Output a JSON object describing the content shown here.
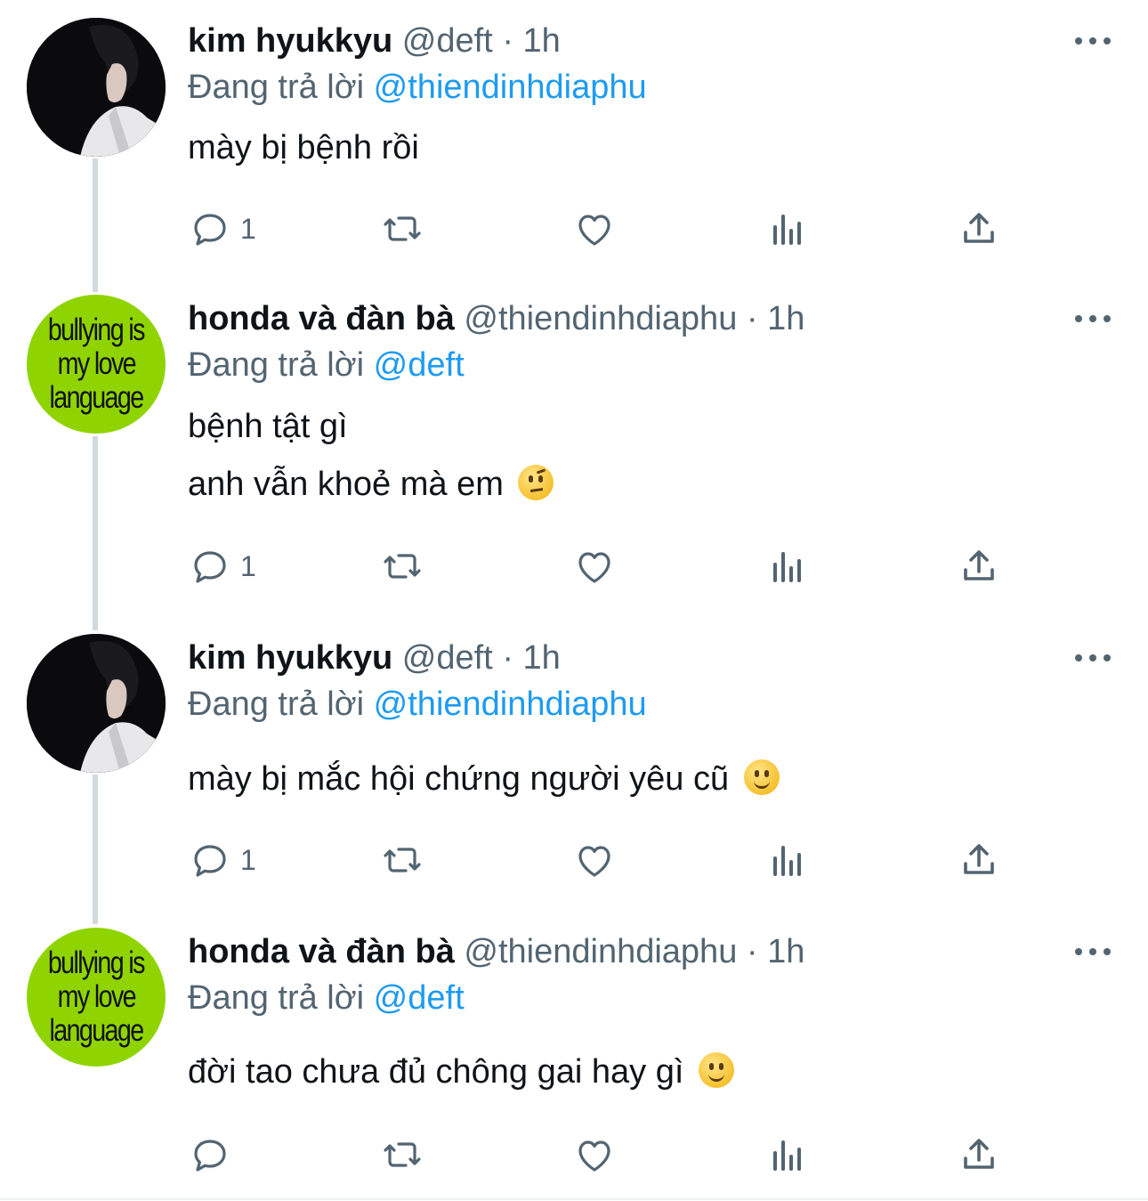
{
  "tweets": [
    {
      "name": "kim hyukkyu",
      "handle": "@deft",
      "time": "1h",
      "reply_prefix": "Đang trả lời",
      "reply_to": "@thiendinhdiaphu",
      "lines": [
        "mày bị bệnh rồi"
      ],
      "emoji": null,
      "reply_count": "1",
      "avatar": "dark-portrait-avatar"
    },
    {
      "name": "honda và đàn bà",
      "handle": "@thiendinhdiaphu",
      "time": "1h",
      "reply_prefix": "Đang trả lời",
      "reply_to": "@deft",
      "lines": [
        "bệnh tật gì",
        "anh vẫn khoẻ mà em"
      ],
      "emoji": "face-with-raised-eyebrow",
      "reply_count": "1",
      "avatar_text": [
        "bullying is",
        "my love",
        "language"
      ]
    },
    {
      "name": "kim hyukkyu",
      "handle": "@deft",
      "time": "1h",
      "reply_prefix": "Đang trả lời",
      "reply_to": "@thiendinhdiaphu",
      "lines": [
        "mày bị mắc hội chứng người yêu cũ"
      ],
      "emoji": "slightly-smiling-face",
      "reply_count": "1",
      "avatar": "dark-portrait-avatar"
    },
    {
      "name": "honda và đàn bà",
      "handle": "@thiendinhdiaphu",
      "time": "1h",
      "reply_prefix": "Đang trả lời",
      "reply_to": "@deft",
      "lines": [
        "đời tao chưa đủ chông gai hay gì"
      ],
      "emoji": "slightly-smiling-face",
      "reply_count": "",
      "avatar_text": [
        "bullying is",
        "my love",
        "language"
      ]
    }
  ],
  "separator": "·",
  "icons": [
    "reply-icon",
    "retweet-icon",
    "like-icon",
    "analytics-icon",
    "share-icon",
    "more-icon"
  ],
  "colors": {
    "text": "#0f1419",
    "secondary": "#536471",
    "link": "#1d9bf0",
    "thread_line": "#cfd9de",
    "avatar_green": "#8fd400"
  }
}
